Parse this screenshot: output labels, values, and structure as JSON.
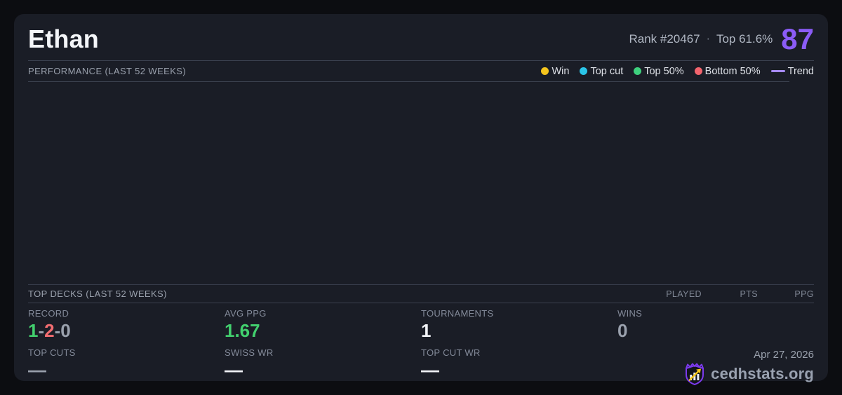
{
  "header": {
    "player_name": "Ethan",
    "rank": "Rank #20467",
    "separator": "·",
    "top_percent": "Top 61.6%",
    "score": "87",
    "score_color": "#8b5cf6"
  },
  "performance": {
    "title": "PERFORMANCE (LAST 52 WEEKS)",
    "legend": [
      {
        "label": "Win",
        "color": "#f5c51d",
        "swatch": "dot"
      },
      {
        "label": "Top cut",
        "color": "#2bc5e8",
        "swatch": "dot"
      },
      {
        "label": "Top 50%",
        "color": "#3ed07d",
        "swatch": "dot"
      },
      {
        "label": "Bottom 50%",
        "color": "#f2646d",
        "swatch": "dot"
      },
      {
        "label": "Trend",
        "color": "#a78bfa",
        "swatch": "line"
      }
    ],
    "chart_points": []
  },
  "top_decks": {
    "title": "TOP DECKS (LAST 52 WEEKS)",
    "columns": [
      "PLAYED",
      "PTS",
      "PPG"
    ],
    "rows": []
  },
  "stats": {
    "record": {
      "label": "RECORD",
      "wins": "1",
      "sep1": "-",
      "losses": "2",
      "sep2": "-",
      "draws": "0"
    },
    "avg_ppg": {
      "label": "AVG PPG",
      "value": "1.67"
    },
    "tournaments": {
      "label": "TOURNAMENTS",
      "value": "1"
    },
    "wins": {
      "label": "WINS",
      "value": "0"
    },
    "top_cuts": {
      "label": "TOP CUTS",
      "value": "—"
    },
    "swiss_wr": {
      "label": "SWISS WR",
      "value": "—"
    },
    "top_cut_wr": {
      "label": "TOP CUT WR",
      "value": "—"
    }
  },
  "footer": {
    "date": "Apr 27, 2026",
    "brand": "cedhstats.org"
  },
  "colors": {
    "background": "#0c0d11",
    "card": "#1a1d26",
    "divider": "#3a404e",
    "accent_purple": "#8b5cf6",
    "win_green": "#42d06e",
    "loss_red": "#f26d71",
    "neutral_gray": "#9aa1ad"
  }
}
